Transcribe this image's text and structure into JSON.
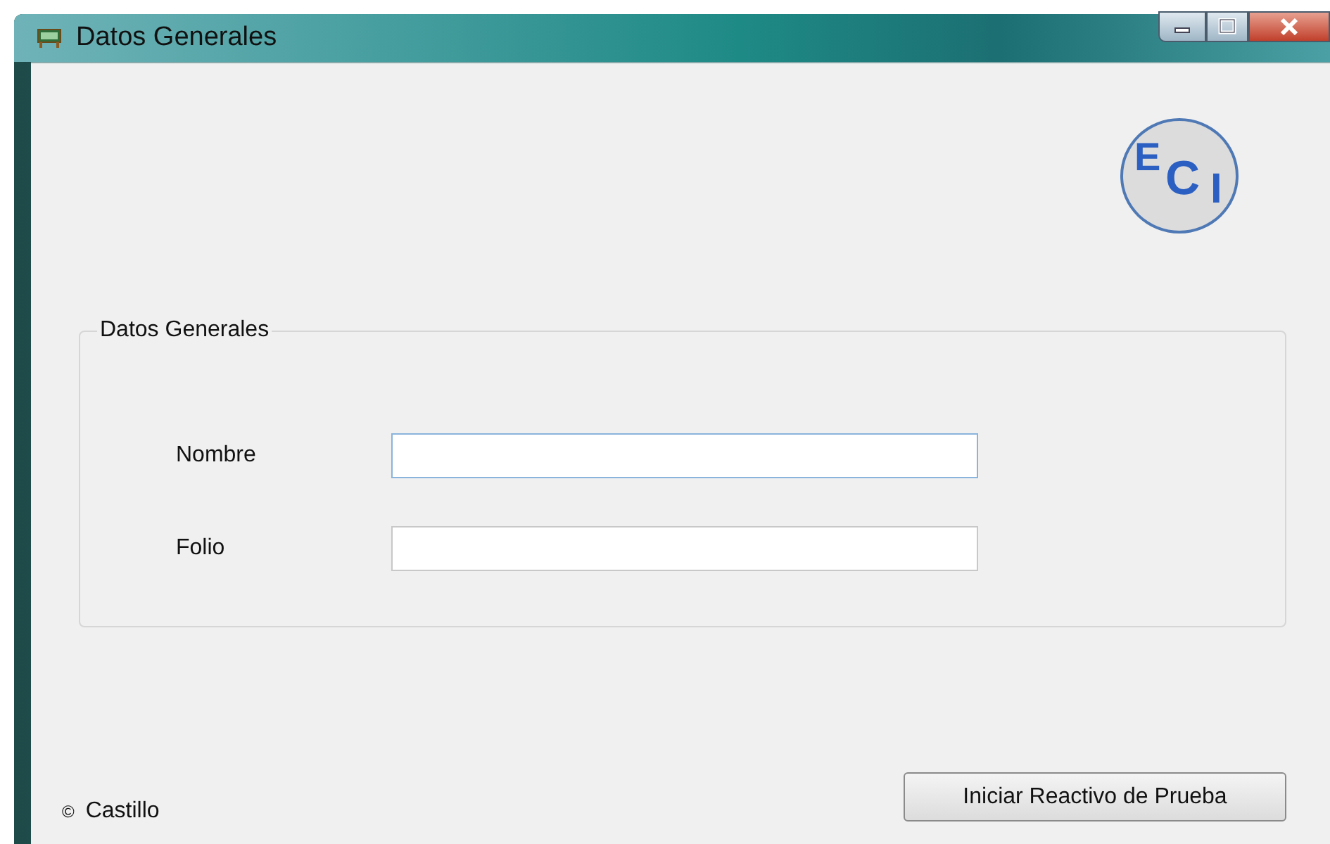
{
  "window": {
    "title": "Datos Generales"
  },
  "logo": {
    "letters": [
      "E",
      "C",
      "I"
    ]
  },
  "group": {
    "title": "Datos Generales",
    "fields": [
      {
        "label": "Nombre",
        "focused": true
      },
      {
        "label": "Folio",
        "focused": false
      }
    ]
  },
  "footer": {
    "mark": "©",
    "text": "Castillo"
  },
  "button": {
    "label": "Iniciar Reactivo de Prueba"
  }
}
